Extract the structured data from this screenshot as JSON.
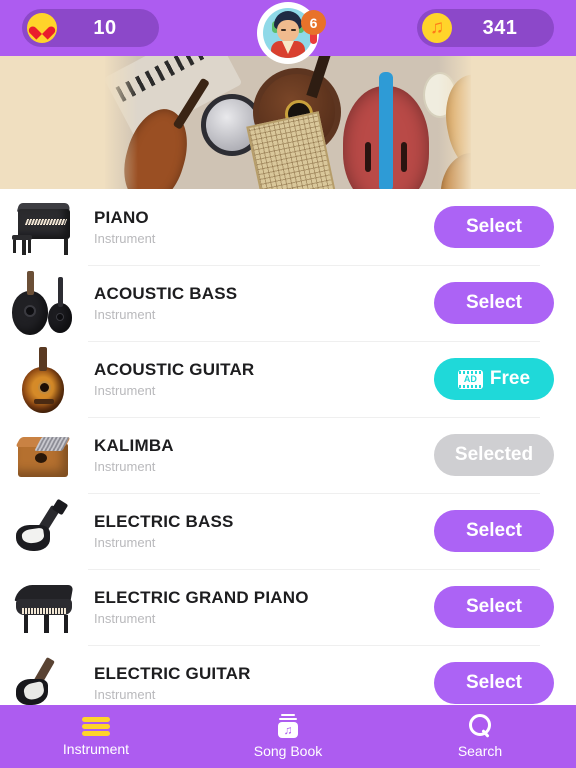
{
  "header": {
    "lives": {
      "icon": "heart-icon",
      "value": "10"
    },
    "coins": {
      "icon": "music-note-icon",
      "value": "341"
    },
    "avatar": {
      "name": "player-avatar",
      "badge": "6"
    }
  },
  "banner": {
    "name": "instruments-hero-image",
    "alt": "assorted musical instruments"
  },
  "list": {
    "subtitle_default": "Instrument",
    "items": [
      {
        "name": "PIANO",
        "subtitle": "Instrument",
        "action": "Select",
        "state": "select",
        "thumb": "piano-thumb"
      },
      {
        "name": "ACOUSTIC BASS",
        "subtitle": "Instrument",
        "action": "Select",
        "state": "select",
        "thumb": "acoustic-bass-thumb"
      },
      {
        "name": "ACOUSTIC GUITAR",
        "subtitle": "Instrument",
        "action": "Free",
        "state": "free",
        "thumb": "acoustic-guitar-thumb",
        "ad_label": "AD"
      },
      {
        "name": "KALIMBA",
        "subtitle": "Instrument",
        "action": "Selected",
        "state": "selected",
        "thumb": "kalimba-thumb"
      },
      {
        "name": "ELECTRIC BASS",
        "subtitle": "Instrument",
        "action": "Select",
        "state": "select",
        "thumb": "electric-bass-thumb"
      },
      {
        "name": "ELECTRIC GRAND PIANO",
        "subtitle": "Instrument",
        "action": "Select",
        "state": "select",
        "thumb": "electric-grand-piano-thumb"
      },
      {
        "name": "ELECTRIC GUITAR",
        "subtitle": "Instrument",
        "action": "Select",
        "state": "select",
        "thumb": "electric-guitar-thumb"
      }
    ]
  },
  "tabbar": {
    "tabs": [
      {
        "label": "Instrument",
        "icon": "hamburger-icon",
        "active": true
      },
      {
        "label": "Song Book",
        "icon": "song-book-icon",
        "active": false
      },
      {
        "label": "Search",
        "icon": "search-icon",
        "active": false
      }
    ]
  },
  "colors": {
    "purple_bar": "#ad5cf0",
    "purple_pill": "#8c48c9",
    "select_button": "#ac63f5",
    "free_button": "#1fd9d9",
    "selected_button": "#cfcfd2",
    "accent_yellow": "#ffd42a",
    "badge_orange": "#e8722a",
    "banner_bg": "#f0dfc0"
  }
}
